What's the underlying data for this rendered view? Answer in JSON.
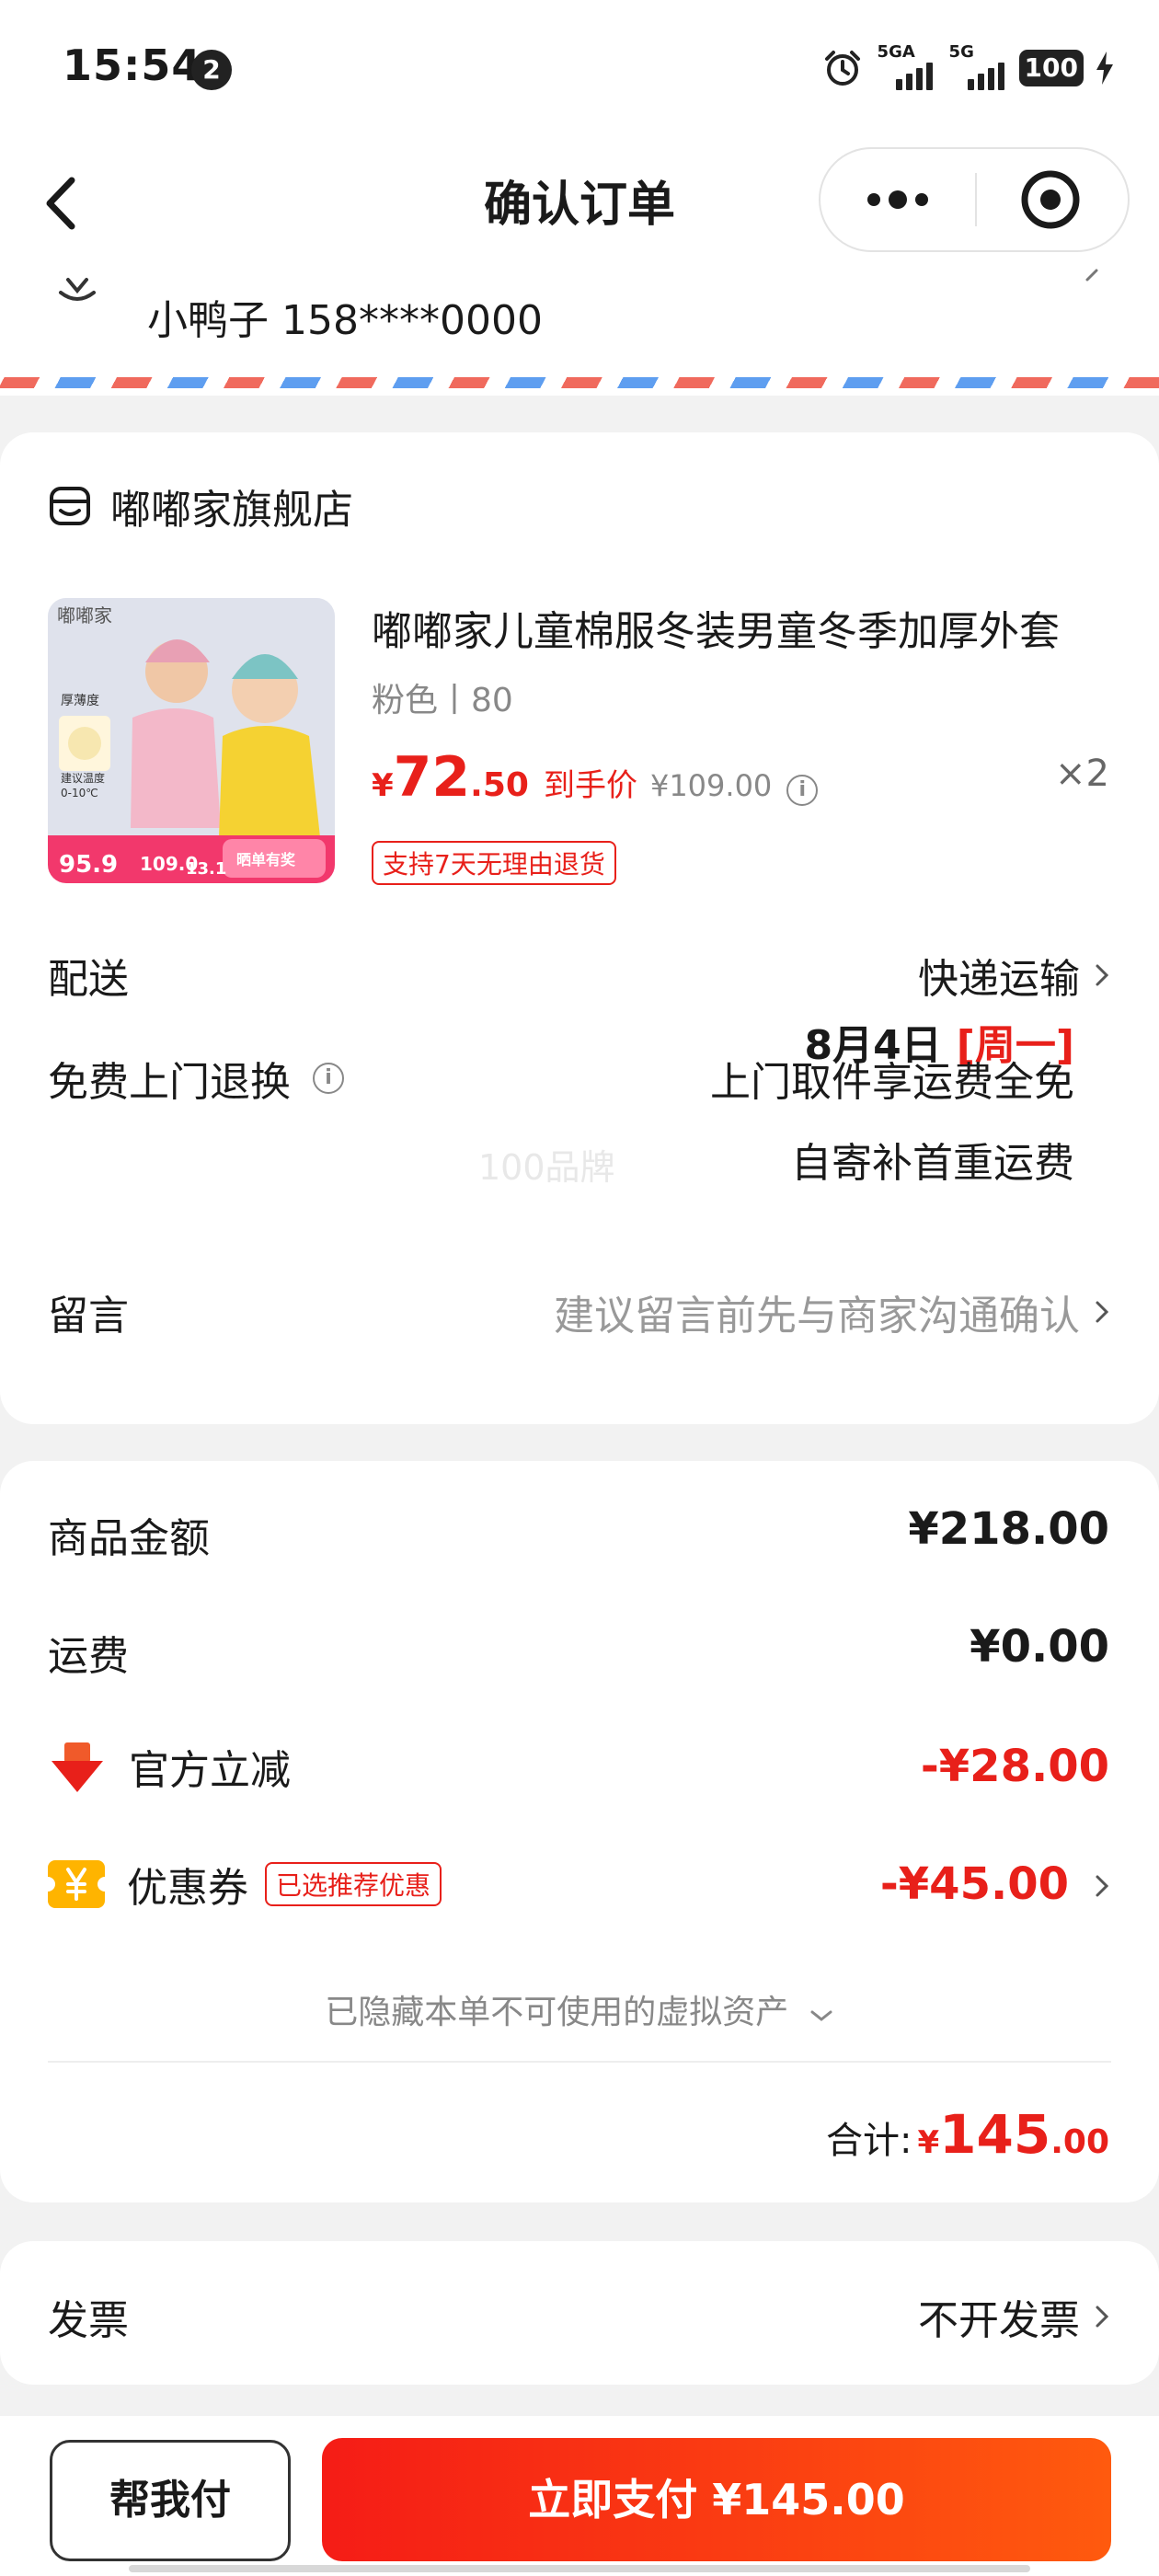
{
  "status_bar": {
    "time": "15:54",
    "notification_count": "2",
    "network_1": "5GA",
    "network_2": "5G",
    "battery": "100"
  },
  "nav": {
    "title": "确认订单"
  },
  "address": {
    "contact": "小鸭子 158****0000"
  },
  "store": {
    "name": "嘟嘟家旗舰店"
  },
  "product": {
    "title": "嘟嘟家儿童棉服冬装男童冬季加厚外套",
    "spec": "粉色丨80",
    "price_yen": "¥",
    "price_int": "72",
    "price_dec": ".50",
    "price_label": "到手价",
    "original_price": "¥109.00",
    "quantity": "×2",
    "refund_tag": "支持7天无理由退货",
    "thumb": {
      "brand": "嘟嘟家",
      "feature": "厚薄度",
      "temp_label": "建议温度",
      "temp_range": "0-10℃",
      "price_a": "95.9",
      "price_b": "109.0",
      "price_c": "13.1",
      "badge": "晒单有奖"
    }
  },
  "delivery": {
    "label": "配送",
    "method": "快递运输",
    "date": "8月4日",
    "weekday": "[周一]"
  },
  "free_return": {
    "label": "免费上门退换",
    "line1": "上门取件享运费全免",
    "line2": "自寄补首重运费",
    "watermark": "100品牌"
  },
  "message": {
    "label": "留言",
    "placeholder": "建议留言前先与商家沟通确认"
  },
  "amounts": {
    "goods_label": "商品金额",
    "goods_value": "¥218.00",
    "shipping_label": "运费",
    "shipping_value": "¥0.00",
    "official_label": "官方立减",
    "official_value": "-¥28.00",
    "coupon_label": "优惠券",
    "coupon_tag": "已选推荐优惠",
    "coupon_value": "-¥45.00",
    "hidden_assets": "已隐藏本单不可使用的虚拟资产",
    "total_label": "合计:",
    "total_yen": "¥",
    "total_int": "145",
    "total_dec": ".00"
  },
  "invoice": {
    "label": "发票",
    "value": "不开发票"
  },
  "bottom": {
    "help_pay": "帮我付",
    "pay_now": "立即支付 ¥145.00"
  },
  "colors": {
    "accent": "#e8201a",
    "pay_gradient_start": "#f51c16",
    "pay_gradient_end": "#ff5a0e"
  }
}
